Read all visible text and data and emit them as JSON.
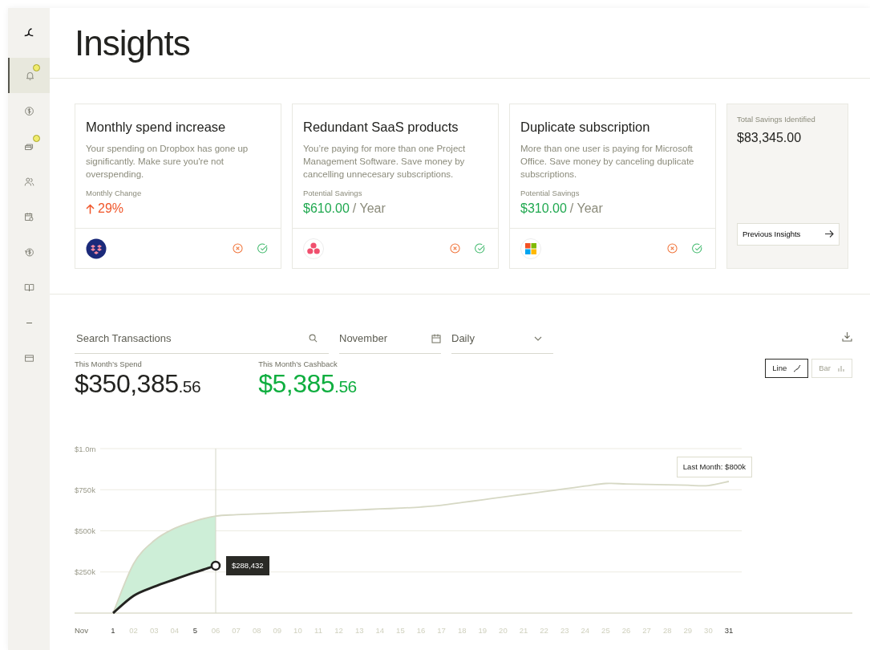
{
  "sidebar": {
    "items": [
      {
        "kind": "logo",
        "selected": false,
        "badge": false
      },
      {
        "kind": "bell",
        "selected": true,
        "badge": true
      },
      {
        "kind": "dollar",
        "selected": false,
        "badge": false
      },
      {
        "kind": "cards",
        "selected": false,
        "badge": true
      },
      {
        "kind": "people",
        "selected": false,
        "badge": false
      },
      {
        "kind": "calendar",
        "selected": false,
        "badge": false
      },
      {
        "kind": "refund",
        "selected": false,
        "badge": false
      },
      {
        "kind": "book",
        "selected": false,
        "badge": false
      },
      {
        "kind": "minus",
        "selected": false,
        "badge": false
      },
      {
        "kind": "card",
        "selected": false,
        "badge": false
      }
    ]
  },
  "page": {
    "title": "Insights"
  },
  "insights": [
    {
      "kind": "dropbox",
      "title": "Monthly spend increase",
      "description": "Your spending on Dropbox has gone up significantly. Make sure you're not overspending.",
      "metric_label": "Monthly Change",
      "metric_value": "29%",
      "increase": true
    },
    {
      "kind": "asana",
      "title": "Redundant SaaS products",
      "description": "You’re paying for more than one Project Management Software. Save money by cancelling unnecesary subscriptions.",
      "metric_label": "Potential Savings",
      "metric_value": "$610.00",
      "increase": false,
      "unit": "/ Year"
    },
    {
      "kind": "microsoft",
      "title": "Duplicate subscription",
      "description": "More than one user is paying for Microsoft Office. Save money by canceling duplicate subscriptions.",
      "metric_label": "Potential Savings",
      "metric_value": "$310.00",
      "increase": false,
      "unit": "/ Year"
    }
  ],
  "savings": {
    "label": "Total Savings Identified",
    "value": "$83,345.00",
    "button": "Previous Insights"
  },
  "filters": {
    "search_placeholder": "Search Transactions",
    "month": "November",
    "period": "Daily"
  },
  "metrics": [
    {
      "label": "This Month’s Spend",
      "whole": "$350,385",
      "cents": ".56",
      "positive": false
    },
    {
      "label": "This Month’s Cashback",
      "whole": "$5,385",
      "cents": ".56",
      "positive": true
    }
  ],
  "chart_types": [
    {
      "label": "Line",
      "kind": "line",
      "selected": true
    },
    {
      "label": "Bar",
      "kind": "bar",
      "selected": false
    }
  ],
  "chart": {
    "month_label": "Nov",
    "day_emphasis": [
      true,
      false,
      false,
      false,
      true,
      false,
      false,
      false,
      false,
      false,
      false,
      false,
      false,
      false,
      false,
      false,
      false,
      false,
      false,
      false,
      false,
      false,
      false,
      false,
      false,
      false,
      false,
      false,
      false,
      false,
      true
    ],
    "tooltips": [
      {
        "text": "$288,432"
      },
      {
        "text": "Last Month: $800k"
      }
    ],
    "chart_data": {
      "type": "line",
      "categories": [
        "1",
        "02",
        "03",
        "04",
        "5",
        "06",
        "07",
        "08",
        "09",
        "10",
        "11",
        "12",
        "13",
        "14",
        "15",
        "16",
        "17",
        "18",
        "19",
        "20",
        "21",
        "22",
        "23",
        "24",
        "25",
        "26",
        "27",
        "28",
        "29",
        "30",
        "31"
      ],
      "series": [
        {
          "color": "#d6d8c4",
          "values": [
            0,
            300000,
            440000,
            515000,
            560000,
            590000,
            598000,
            603000,
            608000,
            613000,
            618000,
            623000,
            628000,
            633000,
            638000,
            645000,
            655000,
            672000,
            689000,
            706000,
            722000,
            738000,
            755000,
            772000,
            788000,
            785000,
            782000,
            780000,
            777000,
            775000,
            800000
          ]
        },
        {
          "color": "#232320",
          "values": [
            0,
            105000,
            160000,
            205000,
            248000,
            288432,
            null,
            null,
            null,
            null,
            null,
            null,
            null,
            null,
            null,
            null,
            null,
            null,
            null,
            null,
            null,
            null,
            null,
            null,
            null,
            null,
            null,
            null,
            null,
            null,
            null
          ]
        }
      ],
      "ylim": [
        0,
        1000000
      ],
      "yticks": [
        {
          "value": 250000,
          "label": "$250k"
        },
        {
          "value": 500000,
          "label": "$500k"
        },
        {
          "value": 750000,
          "label": "$750k"
        },
        {
          "value": 1000000,
          "label": "$1.0m"
        }
      ],
      "grid": true,
      "ref_lines": [
        {
          "axis": "x",
          "value": "06"
        }
      ]
    }
  }
}
